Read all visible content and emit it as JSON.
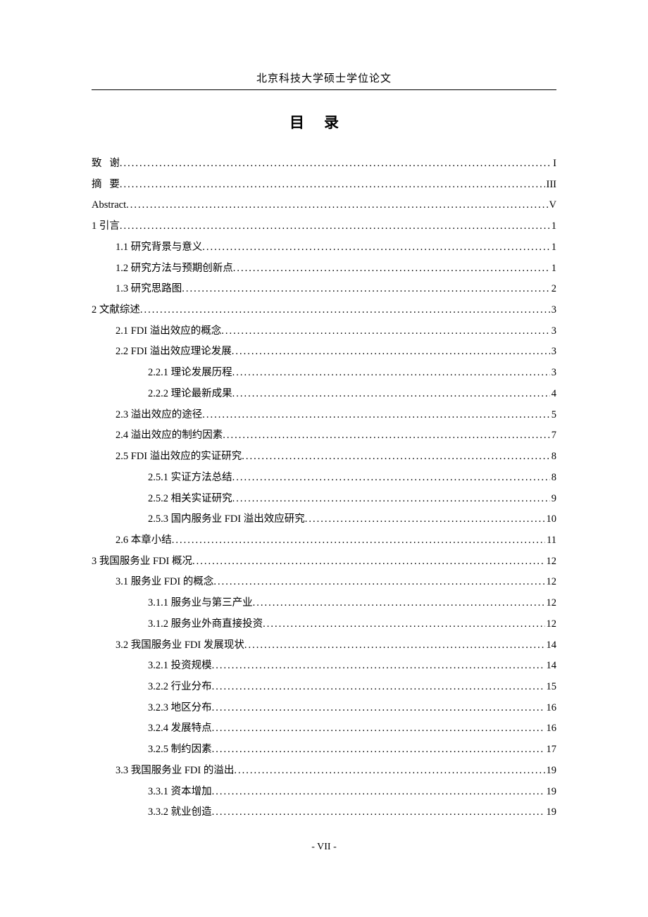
{
  "header": "北京科技大学硕士学位论文",
  "title": "目录",
  "footer": "- VII -",
  "toc": [
    {
      "level": 0,
      "label": "致   谢",
      "page": "I"
    },
    {
      "level": 0,
      "label": "摘   要",
      "page": "III"
    },
    {
      "level": 0,
      "label": "Abstract",
      "page": "V"
    },
    {
      "level": 0,
      "label": "1 引言",
      "page": "1"
    },
    {
      "level": 1,
      "label": "1.1 研究背景与意义",
      "page": "1"
    },
    {
      "level": 1,
      "label": "1.2 研究方法与预期创新点",
      "page": "1"
    },
    {
      "level": 1,
      "label": "1.3 研究思路图",
      "page": "2"
    },
    {
      "level": 0,
      "label": "2 文献综述",
      "page": "3"
    },
    {
      "level": 1,
      "label": "2.1 FDI 溢出效应的概念",
      "page": "3"
    },
    {
      "level": 1,
      "label": "2.2 FDI 溢出效应理论发展",
      "page": "3"
    },
    {
      "level": 2,
      "label": "2.2.1 理论发展历程",
      "page": "3"
    },
    {
      "level": 2,
      "label": "2.2.2 理论最新成果",
      "page": "4"
    },
    {
      "level": 1,
      "label": "2.3 溢出效应的途径",
      "page": "5"
    },
    {
      "level": 1,
      "label": "2.4 溢出效应的制约因素",
      "page": "7"
    },
    {
      "level": 1,
      "label": "2.5 FDI 溢出效应的实证研究",
      "page": "8"
    },
    {
      "level": 2,
      "label": "2.5.1 实证方法总结",
      "page": "8"
    },
    {
      "level": 2,
      "label": "2.5.2 相关实证研究",
      "page": "9"
    },
    {
      "level": 2,
      "label": "2.5.3 国内服务业 FDI 溢出效应研究",
      "page": "10"
    },
    {
      "level": 1,
      "label": "2.6 本章小结",
      "page": "11"
    },
    {
      "level": 0,
      "label": "3 我国服务业 FDI 概况",
      "page": "12"
    },
    {
      "level": 1,
      "label": "3.1 服务业 FDI 的概念",
      "page": "12"
    },
    {
      "level": 2,
      "label": "3.1.1 服务业与第三产业",
      "page": "12"
    },
    {
      "level": 2,
      "label": "3.1.2 服务业外商直接投资",
      "page": "12"
    },
    {
      "level": 1,
      "label": "3.2 我国服务业 FDI 发展现状",
      "page": "14"
    },
    {
      "level": 2,
      "label": "3.2.1 投资规模",
      "page": "14"
    },
    {
      "level": 2,
      "label": "3.2.2 行业分布",
      "page": "15"
    },
    {
      "level": 2,
      "label": "3.2.3 地区分布",
      "page": "16"
    },
    {
      "level": 2,
      "label": "3.2.4 发展特点",
      "page": "16"
    },
    {
      "level": 2,
      "label": "3.2.5 制约因素",
      "page": "17"
    },
    {
      "level": 1,
      "label": "3.3 我国服务业 FDI 的溢出",
      "page": "19"
    },
    {
      "level": 2,
      "label": "3.3.1 资本增加",
      "page": "19"
    },
    {
      "level": 2,
      "label": "3.3.2 就业创造",
      "page": "19"
    }
  ]
}
